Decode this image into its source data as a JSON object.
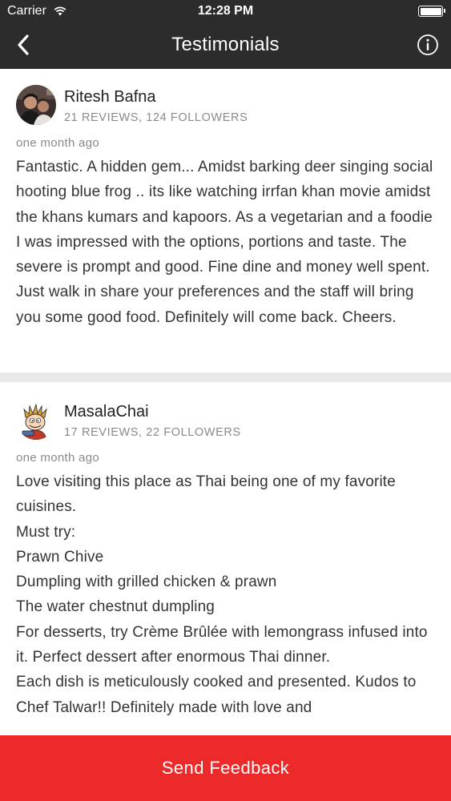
{
  "status_bar": {
    "carrier": "Carrier",
    "time": "12:28 PM"
  },
  "nav": {
    "title": "Testimonials",
    "back_icon": "chevron-left-icon",
    "info_icon": "info-circle-icon"
  },
  "reviews": [
    {
      "name": "Ritesh Bafna",
      "stats": "21 REVIEWS, 124 FOLLOWERS",
      "posted": "one month ago",
      "text": "Fantastic. A hidden gem... Amidst barking deer singing social hooting blue frog .. its like watching irrfan khan movie amidst the khans  kumars and kapoors. As a vegetarian and a foodie I was impressed with the options, portions and taste. The severe is prompt and good. Fine dine and money well spent. Just walk in share your preferences and the staff will bring you some good food. Definitely will come back. Cheers."
    },
    {
      "name": "MasalaChai",
      "stats": "17 REVIEWS, 22 FOLLOWERS",
      "posted": "one month ago",
      "text": "Love visiting this place as Thai being one of my favorite cuisines.\nMust try:\nPrawn Chive\nDumpling with grilled chicken & prawn\nThe water chestnut dumpling\nFor desserts, try Crème Brûlée with lemongrass infused into it. Perfect dessert after enormous Thai dinner.\nEach dish is meticulously cooked and presented. Kudos to Chef Talwar!! Definitely made with love and"
    }
  ],
  "footer": {
    "send_feedback_label": "Send Feedback"
  },
  "colors": {
    "header_bg": "#2c2c2c",
    "accent": "#ed2a2a",
    "divider": "#e9e9e9",
    "meta_text": "#8a8a8a"
  }
}
